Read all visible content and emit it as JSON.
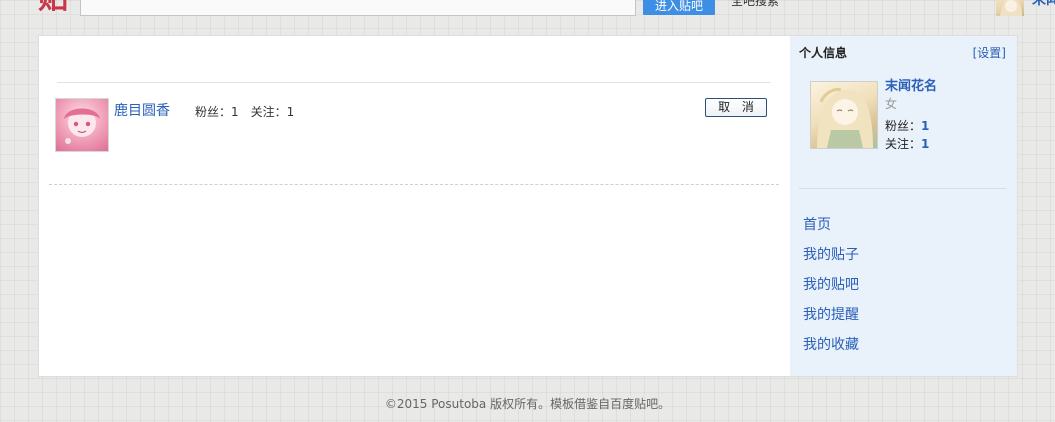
{
  "header": {
    "logo_text": "贴",
    "enter_button": "进入贴吧",
    "global_search": "全吧搜索",
    "username": "末闻"
  },
  "following": {
    "items": [
      {
        "name": "鹿目圆香",
        "fans_label": "粉丝：",
        "fans_count": "1",
        "follow_label": "关注：",
        "follow_count": "1",
        "cancel_label": "取 消"
      }
    ]
  },
  "sidebar": {
    "title": "个人信息",
    "settings": "[设置]",
    "profile": {
      "name": "末闻花名",
      "gender": "女",
      "fans_label": "粉丝：",
      "fans_count": "1",
      "follow_label": "关注：",
      "follow_count": "1"
    },
    "nav": [
      {
        "label": "首页"
      },
      {
        "label": "我的贴子"
      },
      {
        "label": "我的贴吧"
      },
      {
        "label": "我的提醒"
      },
      {
        "label": "我的收藏"
      }
    ]
  },
  "footer": {
    "copyright": "©2015 Posutoba 版权所有。模板借鉴自百度贴吧。"
  },
  "colors": {
    "link": "#2a60b9",
    "primary_button": "#3d8ee4",
    "sidebar_bg": "#e9f1fa",
    "logo": "#c9364b"
  }
}
